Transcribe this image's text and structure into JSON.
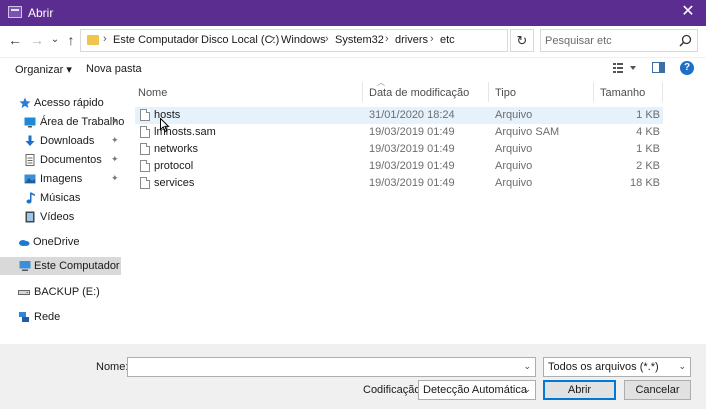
{
  "window": {
    "title": "Abrir",
    "close_glyph": "✕"
  },
  "nav_buttons": {
    "back": "←",
    "forward": "→",
    "dropdown": "⌄",
    "up": "↑"
  },
  "address": {
    "crumbs": [
      "Este Computador",
      "Disco Local (C:)",
      "Windows",
      "System32",
      "drivers",
      "etc"
    ],
    "separator": "›",
    "dropdown_glyph": "⌄",
    "refresh_glyph": "↻"
  },
  "search": {
    "placeholder": "Pesquisar etc",
    "icon": "search-icon"
  },
  "toolbar": {
    "organize": "Organizar ▾",
    "new_folder": "Nova pasta",
    "help": "?"
  },
  "sidebar": {
    "items": [
      {
        "label": "Acesso rápido",
        "icon": "star-icon",
        "pinned": false
      },
      {
        "label": "Área de Trabalho",
        "icon": "desktop-icon",
        "pinned": true
      },
      {
        "label": "Downloads",
        "icon": "download-icon",
        "pinned": true
      },
      {
        "label": "Documentos",
        "icon": "documents-icon",
        "pinned": true
      },
      {
        "label": "Imagens",
        "icon": "pictures-icon",
        "pinned": true
      },
      {
        "label": "Músicas",
        "icon": "music-icon",
        "pinned": false
      },
      {
        "label": "Vídeos",
        "icon": "videos-icon",
        "pinned": false
      },
      {
        "label": "OneDrive",
        "icon": "cloud-icon",
        "pinned": false
      },
      {
        "label": "Este Computador",
        "icon": "computer-icon",
        "pinned": false,
        "selected": true
      },
      {
        "label": "BACKUP (E:)",
        "icon": "drive-icon",
        "pinned": false
      },
      {
        "label": "Rede",
        "icon": "network-icon",
        "pinned": false
      }
    ],
    "pin_glyph": "📌"
  },
  "file_list": {
    "columns": [
      "Nome",
      "Data de modificação",
      "Tipo",
      "Tamanho"
    ],
    "rows": [
      {
        "name": "hosts",
        "date": "31/01/2020 18:24",
        "type": "Arquivo",
        "size": "1 KB",
        "hover": true
      },
      {
        "name": "lmhosts.sam",
        "date": "19/03/2019 01:49",
        "type": "Arquivo SAM",
        "size": "4 KB"
      },
      {
        "name": "networks",
        "date": "19/03/2019 01:49",
        "type": "Arquivo",
        "size": "1 KB"
      },
      {
        "name": "protocol",
        "date": "19/03/2019 01:49",
        "type": "Arquivo",
        "size": "2 KB"
      },
      {
        "name": "services",
        "date": "19/03/2019 01:49",
        "type": "Arquivo",
        "size": "18 KB"
      }
    ]
  },
  "bottom": {
    "name_label": "Nome:",
    "name_value": "",
    "filter_value": "Todos os arquivos  (*.*)",
    "encoding_label": "Codificação:",
    "encoding_value": "Detecção Automática",
    "open_button": "Abrir",
    "cancel_button": "Cancelar",
    "dropdown_glyph": "⌄"
  },
  "colors": {
    "titlebar": "#5c2d91",
    "accent": "#0078d7",
    "hover_row": "#e5f1fb"
  }
}
